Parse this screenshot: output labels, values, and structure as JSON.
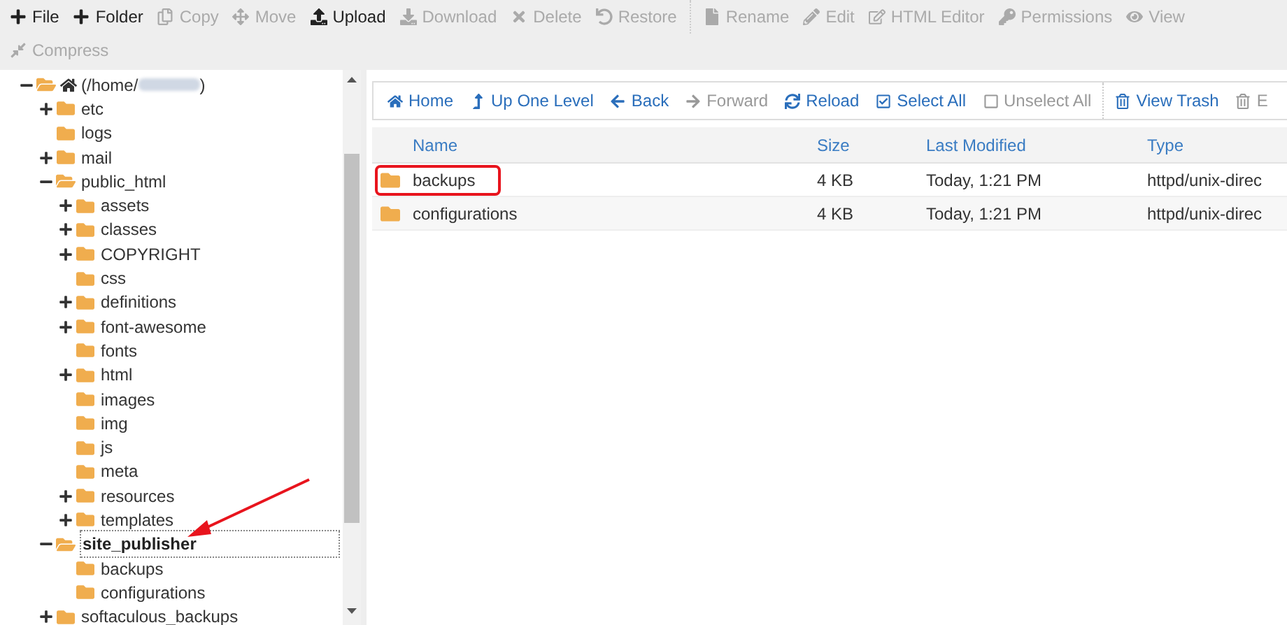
{
  "toolbar": [
    {
      "label": "File",
      "disabled": false
    },
    {
      "label": "Folder",
      "disabled": false
    },
    {
      "label": "Copy",
      "disabled": true
    },
    {
      "label": "Move",
      "disabled": true
    },
    {
      "label": "Upload",
      "disabled": false
    },
    {
      "label": "Download",
      "disabled": true
    },
    {
      "label": "Delete",
      "disabled": true
    },
    {
      "label": "Restore",
      "disabled": true
    },
    {
      "label": "Rename",
      "disabled": true
    },
    {
      "label": "Edit",
      "disabled": true
    },
    {
      "label": "HTML Editor",
      "disabled": true
    },
    {
      "label": "Permissions",
      "disabled": true
    },
    {
      "label": "View",
      "disabled": true
    },
    {
      "label": "Compress",
      "disabled": true
    }
  ],
  "tree": [
    {
      "label": "(/home/",
      "label_end": ")",
      "expanded": true,
      "selected": false,
      "children": [
        {
          "label": "etc",
          "expanded": false,
          "selected": false
        },
        {
          "label": "logs",
          "selected": false
        },
        {
          "label": "mail",
          "expanded": false,
          "selected": false
        },
        {
          "label": "public_html",
          "expanded": true,
          "selected": false,
          "children": [
            {
              "label": "assets",
              "expanded": false,
              "selected": false
            },
            {
              "label": "classes",
              "expanded": false,
              "selected": false
            },
            {
              "label": "COPYRIGHT",
              "expanded": false,
              "selected": false
            },
            {
              "label": "css",
              "selected": false
            },
            {
              "label": "definitions",
              "expanded": false,
              "selected": false
            },
            {
              "label": "font-awesome",
              "expanded": false,
              "selected": false
            },
            {
              "label": "fonts",
              "selected": false
            },
            {
              "label": "html",
              "expanded": false,
              "selected": false
            },
            {
              "label": "images",
              "selected": false
            },
            {
              "label": "img",
              "selected": false
            },
            {
              "label": "js",
              "selected": false
            },
            {
              "label": "meta",
              "selected": false
            },
            {
              "label": "resources",
              "expanded": false,
              "selected": false
            },
            {
              "label": "templates",
              "expanded": false,
              "selected": false
            }
          ]
        },
        {
          "label": "site_publisher",
          "expanded": true,
          "selected": true,
          "children": [
            {
              "label": "backups",
              "selected": false
            },
            {
              "label": "configurations",
              "selected": false
            }
          ]
        },
        {
          "label": "softaculous_backups",
          "expanded": false,
          "selected": false
        }
      ]
    }
  ],
  "nav": [
    {
      "label": "Home",
      "disabled": false
    },
    {
      "label": "Up One Level",
      "disabled": false
    },
    {
      "label": "Back",
      "disabled": false
    },
    {
      "label": "Forward",
      "disabled": true
    },
    {
      "label": "Reload",
      "disabled": false
    },
    {
      "label": "Select All",
      "disabled": false
    },
    {
      "label": "Unselect All",
      "disabled": true
    },
    {
      "label": "View Trash",
      "disabled": false
    },
    {
      "label": "E",
      "disabled": true
    }
  ],
  "table": {
    "columns": [
      "Name",
      "Size",
      "Last Modified",
      "Type"
    ],
    "rows": [
      {
        "name": "backups",
        "size": "4 KB",
        "modified": "Today, 1:21 PM",
        "type": "httpd/unix-direc",
        "highlighted": true
      },
      {
        "name": "configurations",
        "size": "4 KB",
        "modified": "Today, 1:21 PM",
        "type": "httpd/unix-direc",
        "highlighted": false
      }
    ]
  }
}
